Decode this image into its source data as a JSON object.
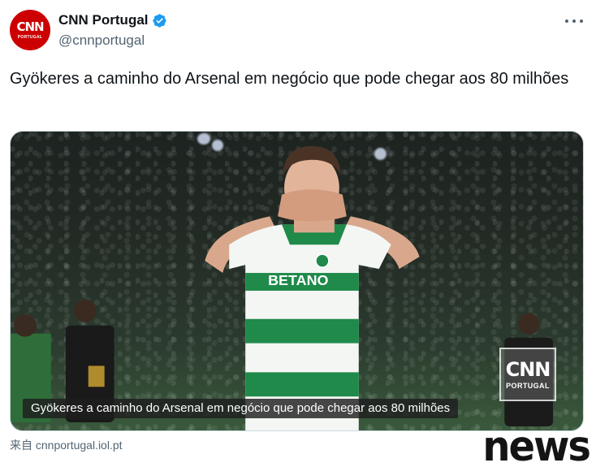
{
  "account": {
    "display_name": "CNN Portugal",
    "handle": "@cnnportugal",
    "avatar_logo": "CNN",
    "avatar_subtitle": "PORTUGAL",
    "verified": true,
    "verified_color": "#1d9bf0",
    "brand_color": "#cc0000"
  },
  "tweet": {
    "text": "Gyökeres a caminho do Arsenal em negócio que pode chegar aos 80 milhões"
  },
  "media": {
    "caption": "Gyökeres a caminho do Arsenal em negócio que pode chegar aos 80 milhões",
    "jersey_sponsor": "BETANO",
    "watermark_logo": "CNN",
    "watermark_subtitle": "PORTUGAL"
  },
  "footer": {
    "source": "来自 cnnportugal.iol.pt",
    "news_logo": "news"
  },
  "icons": {
    "more": "more-icon",
    "verified": "verified-badge-icon"
  }
}
